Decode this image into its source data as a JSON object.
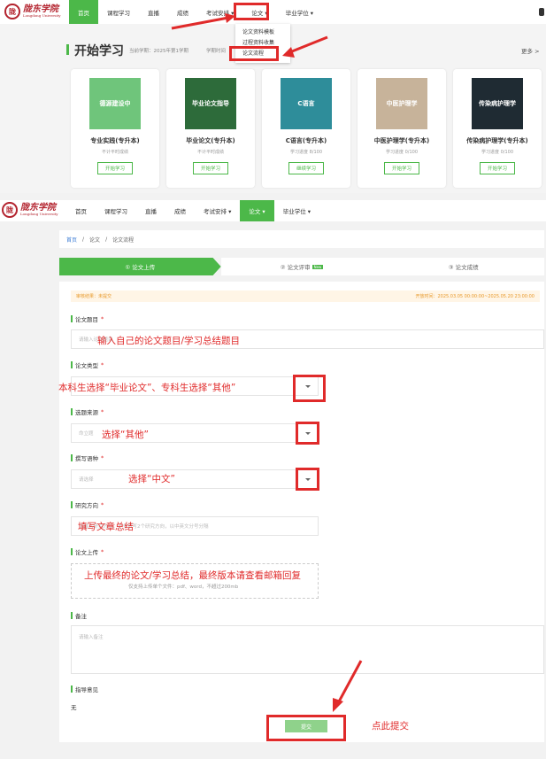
{
  "top": {
    "logo_cn": "陇东学院",
    "logo_en": "Longdong University",
    "nav": [
      "首页",
      "课程学习",
      "直播",
      "成绩",
      "考试安排 ▾",
      "论文 ▾",
      "毕业学位 ▾"
    ],
    "dropdown": [
      "论文资料模板",
      "过程资料收集",
      "论文流程"
    ],
    "section_title": "开始学习",
    "semester": "当前学期：2025年第1学期",
    "semester_extra": "学期时间",
    "more": "更多 >",
    "courses": [
      {
        "title": "专业实践(专升本)",
        "sub": "不计平时成绩",
        "btn": "开始学习",
        "cover_text": "德源建设中",
        "cover_color": "#6fc57b"
      },
      {
        "title": "毕业论文(专升本)",
        "sub": "不计平时成绩",
        "btn": "开始学习",
        "cover_text": "毕业论文指导",
        "cover_color": "#2d6b3a"
      },
      {
        "title": "C语言(专升本)",
        "sub": "学习进度 8/100",
        "btn": "继续学习",
        "cover_text": "C语言",
        "cover_color": "#2e8d9a"
      },
      {
        "title": "中医护理学(专升本)",
        "sub": "学习进度 0/100",
        "btn": "开始学习",
        "cover_text": "中医护理学",
        "cover_color": "#c7b39a"
      },
      {
        "title": "传染病护理学(专升本)",
        "sub": "学习进度 0/100",
        "btn": "开始学习",
        "cover_text": "传染病护理学",
        "cover_color": "#1f2b33"
      }
    ]
  },
  "second": {
    "nav": [
      "首页",
      "课程学习",
      "直播",
      "成绩",
      "考试安排 ▾",
      "论文 ▾",
      "毕业学位 ▾"
    ],
    "breadcrumb": [
      "首页",
      "论文",
      "论文流程"
    ],
    "steps": [
      "① 论文上传",
      "② 论文评审",
      "③ 论文成绩"
    ],
    "steps_badge": "New",
    "notice_left": "审核结果：未提交",
    "notice_right": "开放时间：2025.03.05 00:00:00~2025.05.20 23:00:00",
    "fields": {
      "title": {
        "label": "论文题目",
        "placeholder": "请输入论文题目"
      },
      "type": {
        "label": "论文类型",
        "placeholder": ""
      },
      "source": {
        "label": "选题来源",
        "placeholder": "命立题"
      },
      "lang": {
        "label": "撰写语种",
        "placeholder": "请选择"
      },
      "direction": {
        "label": "研究方向",
        "placeholder": "请输入研究方向，至多填写2个研究方向，以中英文分号分隔"
      },
      "upload": {
        "label": "论文上传",
        "hint": "仅支持上传单个文件：pdf、word，不超过200mb"
      },
      "remark": {
        "label": "备注",
        "placeholder": "请输入备注"
      },
      "advice": {
        "label": "指导意见",
        "value": "无"
      }
    },
    "submit": "提交"
  },
  "annotations": {
    "title": "输入自己的论文题目/学习总结题目",
    "type": "本科生选择“毕业论文”、专科生选择“其他”",
    "source": "选择“其他”",
    "lang": "选择“中文”",
    "direction": "填写文章总结",
    "upload": "上传最终的论文/学习总结，最终版本请查看邮箱回复",
    "submit": "点此提交"
  },
  "colors": {
    "accent": "#4cb849",
    "annotation": "#e02a2a"
  }
}
